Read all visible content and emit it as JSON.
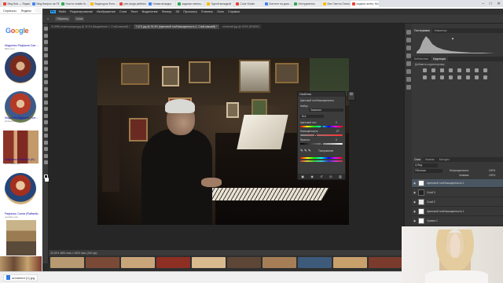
{
  "browser": {
    "tabs": [
      {
        "label": "Bing Bok — Яндекс"
      },
      {
        "label": "Bing Вопрос на ПК"
      },
      {
        "label": "How to enable th…"
      },
      {
        "label": "Видеоурок Фото…"
      },
      {
        "label": "peb-tanga pebbles"
      },
      {
        "label": "Новая вкладка"
      },
      {
        "label": "задачки ответы…"
      },
      {
        "label": "Одной вкладкой"
      },
      {
        "label": "Color Studio"
      },
      {
        "label": "Контент на диск…"
      },
      {
        "label": "Инструменты"
      },
      {
        "label": "Все Светло-Темно…"
      },
      {
        "label": "модели актёр: Мо…"
      }
    ],
    "window_controls": [
      "–",
      "□",
      "✕"
    ],
    "bookmarks": [
      "Сервисы",
      "Яндекс"
    ]
  },
  "google": {
    "logo": "Google",
    "results": [
      {
        "title": "Мадонны Рафаэля Сан…",
        "source": "flickr.com"
      },
      {
        "title": "Мадонна Рафаэля | Кат…",
        "source": "pinterest.ru"
      },
      {
        "title": "Мадонны Рафаэля (И)…",
        "source": "artrenewal.org"
      },
      {
        "title": "Рафаэль Санти (Raffaello…",
        "source": "youtube.com"
      }
    ]
  },
  "photoshop": {
    "menu": [
      "Файл",
      "Редактирование",
      "Изображение",
      "Слои",
      "Текст",
      "Выделение",
      "Фильтр",
      "3D",
      "Просмотр",
      "Плагины",
      "Окно",
      "Справка"
    ],
    "options": [
      "Образец",
      "Слои"
    ],
    "doc_tabs": [
      {
        "label": "Ф-0598 иллюстрация.jpg @ 33.3% (Выделение 1, Слой-маска/8) *",
        "active": false
      },
      {
        "label": "7 (07).jpg @ 33,3% (Цветовой тон/Насыщенность 2, Слой-маска/8) *",
        "active": true
      },
      {
        "label": "minecraft.jpg @ 100% (RGB/8*)",
        "active": false
      }
    ],
    "status": "33,33%     4851 пикс х 3200 пикс (240 ppi)",
    "properties": {
      "title": "Свойства",
      "subtitle": "Цветовой тон/Насыщенность",
      "preset_label": "Набор:",
      "preset_value": "Заказная",
      "channel_value": "Все",
      "hue_label": "Цветовой тон:",
      "hue_value": "0",
      "saturation_label": "Насыщенность:",
      "saturation_value": "-27",
      "lightness_label": "Яркость:",
      "lightness_value": "0",
      "colorize_label": "Тонирование",
      "hue_fraction": 0.5,
      "saturation_fraction": 0.365,
      "lightness_fraction": 0.5
    },
    "histogram_tabs": [
      "Гистограмма",
      "Навигатор"
    ],
    "adjust_tabs": [
      "Библиотеки",
      "Коррекция"
    ],
    "adjust_hint": "Добавить корректировку",
    "layer_tabs": [
      "Слои",
      "Каналы",
      "Контуры"
    ],
    "layer_controls": {
      "kind": "Q Вид",
      "blend": "Обычные",
      "opacity_label": "Непрозрачность:",
      "opacity": "100%",
      "fill_label": "Заливка:",
      "fill": "100%"
    },
    "layers": [
      {
        "name": "Цветовой тон/Насыщенность 2",
        "selected": true
      },
      {
        "name": "Слой 3",
        "selected": false
      },
      {
        "name": "Слой 2",
        "selected": false
      },
      {
        "name": "Цветовой тон/Насыщенность 1",
        "selected": false
      },
      {
        "name": "Уровни 1",
        "selected": false
      },
      {
        "name": "Слой 1",
        "selected": false
      }
    ]
  },
  "taskbar": {
    "file": "unnamed (1).jpg"
  },
  "colors": {
    "ps_bg": "#2b2b2b",
    "accent": "#4b5663"
  }
}
